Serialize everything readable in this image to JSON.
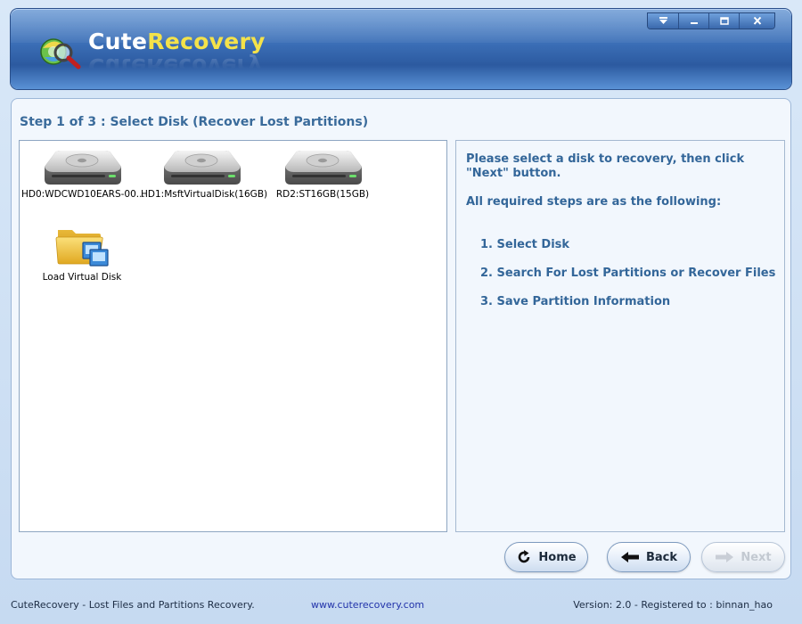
{
  "app": {
    "brand_part1": "Cute",
    "brand_part2": "Recovery",
    "brand_reflection": "CuteRecovery"
  },
  "window_controls": {
    "menu_icon": "dropdown-arrow-icon",
    "minimize_icon": "minimize-icon",
    "maximize_icon": "maximize-icon",
    "close_icon": "close-icon"
  },
  "step": {
    "title": "Step 1 of 3 : Select Disk (Recover Lost Partitions)"
  },
  "disks": [
    {
      "label": "HD0:WDCWD10EARS-00...",
      "icon": "hard-disk-icon"
    },
    {
      "label": "HD1:MsftVirtualDisk(16GB)",
      "icon": "hard-disk-icon"
    },
    {
      "label": "RD2:ST16GB(15GB)",
      "icon": "hard-disk-icon"
    },
    {
      "label": "Load Virtual Disk",
      "icon": "folder-virtual-disk-icon"
    }
  ],
  "info": {
    "intro": "Please select a disk to recovery, then click \"Next\" button.",
    "subheading": "All required steps are as the following:",
    "steps": [
      "1. Select Disk",
      "2. Search For Lost Partitions or Recover Files",
      "3. Save Partition Information"
    ]
  },
  "buttons": {
    "home": "Home",
    "back": "Back",
    "next": "Next"
  },
  "status": {
    "left": "CuteRecovery - Lost Files and Partitions Recovery.",
    "url": "www.cuterecovery.com",
    "version": "Version: 2.0 - Registered to : binnan_hao"
  },
  "colors": {
    "header": "#3a6db5",
    "brand_accent": "#f4e24a",
    "text_blue": "#336699"
  }
}
